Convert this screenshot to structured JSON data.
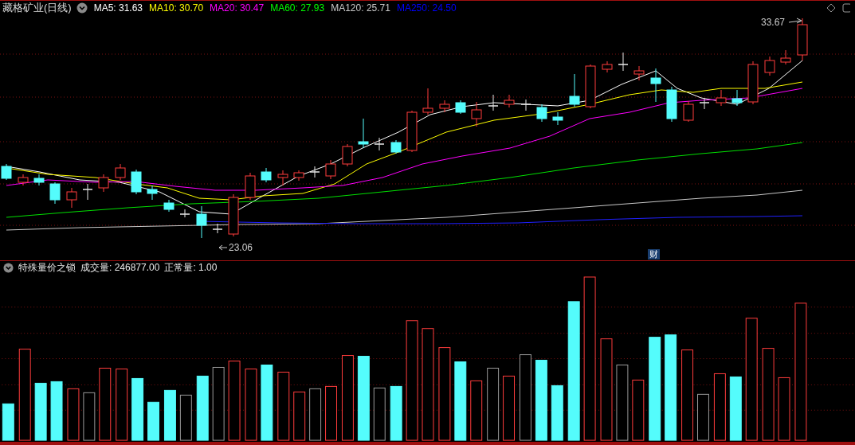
{
  "chart_header": {
    "title": "藏格矿业(日线)",
    "moving_averages": [
      {
        "text": "MA5: 31.63",
        "color": "#ffffff"
      },
      {
        "text": "MA10: 30.70",
        "color": "#ffff00"
      },
      {
        "text": "MA20: 30.47",
        "color": "#ff00ff"
      },
      {
        "text": "MA60: 27.93",
        "color": "#00ff00"
      },
      {
        "text": "MA120: 25.71",
        "color": "#c8c8c8"
      },
      {
        "text": "MA250: 24.50",
        "color": "#0000ff"
      }
    ]
  },
  "price_chart": {
    "high_label": "33.67",
    "low_label": "23.06",
    "event_badge": "财"
  },
  "volume_header": {
    "title": "特殊量价之锁",
    "readings": [
      "成交量: 246877.00",
      "正常量: 1.00"
    ]
  }
}
